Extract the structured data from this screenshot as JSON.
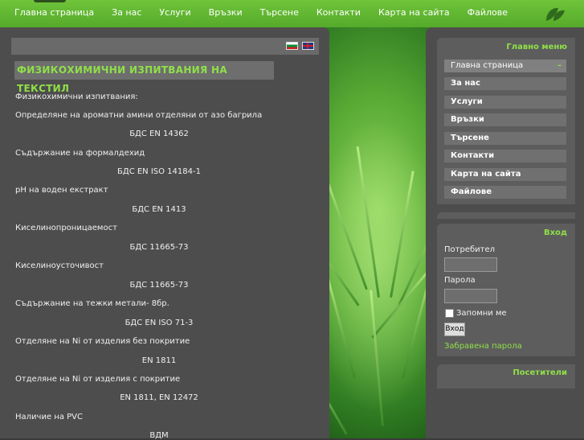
{
  "nav": {
    "items": [
      "Главна страница",
      "За нас",
      "Услуги",
      "Връзки",
      "Търсене",
      "Контакти",
      "Карта на сайта",
      "Файлове"
    ]
  },
  "languages": {
    "bg_icon": "bulgarian-flag-icon",
    "en_icon": "uk-flag-icon"
  },
  "article": {
    "title": "ФИЗИКОХИМИЧНИ ИЗПИТВАНИЯ НА ТЕКСТИЛ",
    "lines": [
      "Физикохимични изпитвания:",
      "Определяне на ароматни амини отделяни от азо багрила",
      "БДС EN 14362",
      "Съдържание на формалдехид",
      "БДС EN ISO 14184-1",
      "pH на воден екстракт",
      "БДС EN 1413",
      "Киселинопроницаемост",
      "БДС 11665-73",
      "Киселиноусточивост",
      "БДС 11665-73",
      "Съдържание на тежки метали- 8бр.",
      "БДС EN ISO 71-3",
      "Отделяне на Ni от изделия без покритие",
      "EN 1811",
      "Отделяне на Ni от изделия с покритие",
      "EN 1811, EN 12472",
      "Наличие на PVC",
      "ВДМ"
    ]
  },
  "main_menu": {
    "title": "Главно меню",
    "items": [
      "Главна страница",
      "За нас",
      "Услуги",
      "Връзки",
      "Търсене",
      "Контакти",
      "Карта на сайта",
      "Файлове"
    ],
    "active_marker": "–"
  },
  "login": {
    "title": "Вход",
    "username_label": "Потребител",
    "password_label": "Парола",
    "remember_label": "Запомни ме",
    "submit_label": "Вход",
    "forgot_label": "Забравена парола"
  },
  "visitors": {
    "title": "Посетители"
  },
  "colors": {
    "accent": "#8fe048",
    "nav_bg": "#6fc43a",
    "panel": "#4d4d4d"
  }
}
